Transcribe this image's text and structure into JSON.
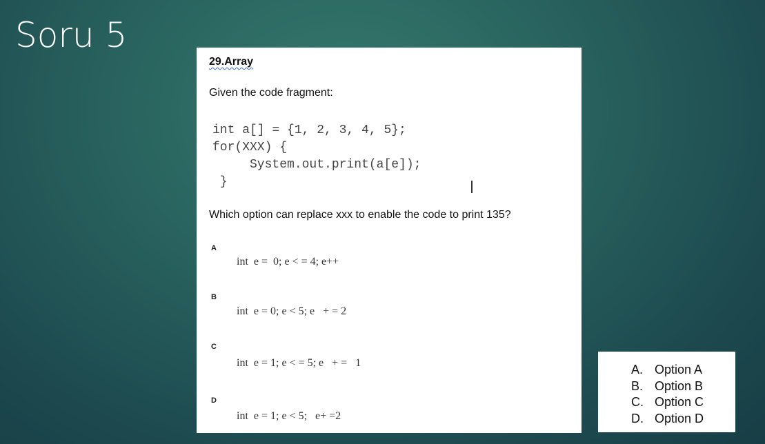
{
  "slide_title": "Soru 5",
  "question_card": {
    "heading": "29.Array",
    "intro": "Given the code fragment:",
    "code_lines": [
      "int a[] = {1, 2, 3, 4, 5};",
      "for(XXX) {",
      "     System.out.print(a[e]);",
      " }"
    ],
    "question": "Which option can replace xxx to enable the code to print 135?",
    "options": [
      {
        "letter": "A",
        "code": "int  e =  0; e < = 4; e++"
      },
      {
        "letter": "B",
        "code": "int  e = 0; e < 5; e   + = 2"
      },
      {
        "letter": "C",
        "code": "int  e = 1; e < = 5; e   + =   1"
      },
      {
        "letter": "D",
        "code": "int  e = 1; e < 5;   e+ =2"
      }
    ]
  },
  "answers": [
    {
      "letter": "A.",
      "label": "Option A"
    },
    {
      "letter": "B.",
      "label": "Option B"
    },
    {
      "letter": "C.",
      "label": "Option C"
    },
    {
      "letter": "D.",
      "label": "Option D"
    }
  ]
}
